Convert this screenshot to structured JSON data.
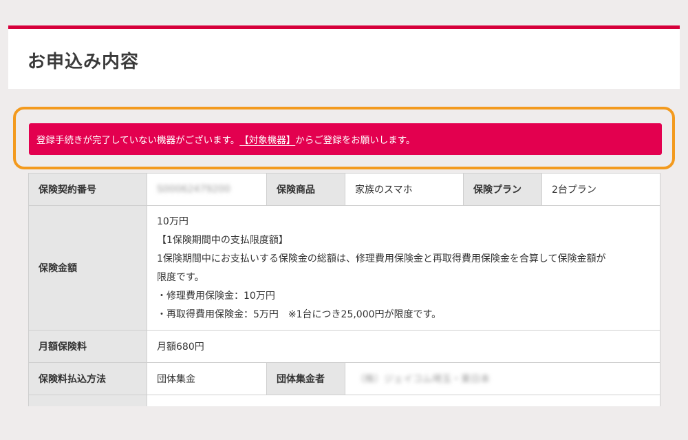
{
  "header": {
    "title": "お申込み内容"
  },
  "alert": {
    "text_before": "登録手続きが完了していない機器がございます。",
    "link_label": "【対象機器】",
    "text_after": "からご登録をお願いします。"
  },
  "contract": {
    "number_label": "保険契約番号",
    "number_value": "S00062479200",
    "product_label": "保険商品",
    "product_value": "家族のスマホ",
    "plan_label": "保険プラン",
    "plan_value": "2台プラン",
    "coverage_label": "保険金額",
    "coverage_lines": [
      "10万円",
      "【1保険期間中の支払限度額】",
      "1保険期間中にお支払いする保険金の総額は、修理費用保険金と再取得費用保険金を合算して保険金額が",
      "限度です。",
      "・修理費用保険金：10万円",
      "・再取得費用保険金：5万円　※1台につき25,000円が限度です。"
    ],
    "premium_label": "月額保険料",
    "premium_value": "月額680円",
    "payment_label": "保険料払込方法",
    "payment_value": "団体集金",
    "collector_label": "団体集金者",
    "collector_value": "（株）ジェイコム埼玉・東日本"
  },
  "colors": {
    "accent": "#d6003b",
    "alert_background": "#e3004f",
    "highlight_frame": "#f39a1e",
    "header_cell": "#e6e6e6",
    "page_background": "#efecec"
  }
}
